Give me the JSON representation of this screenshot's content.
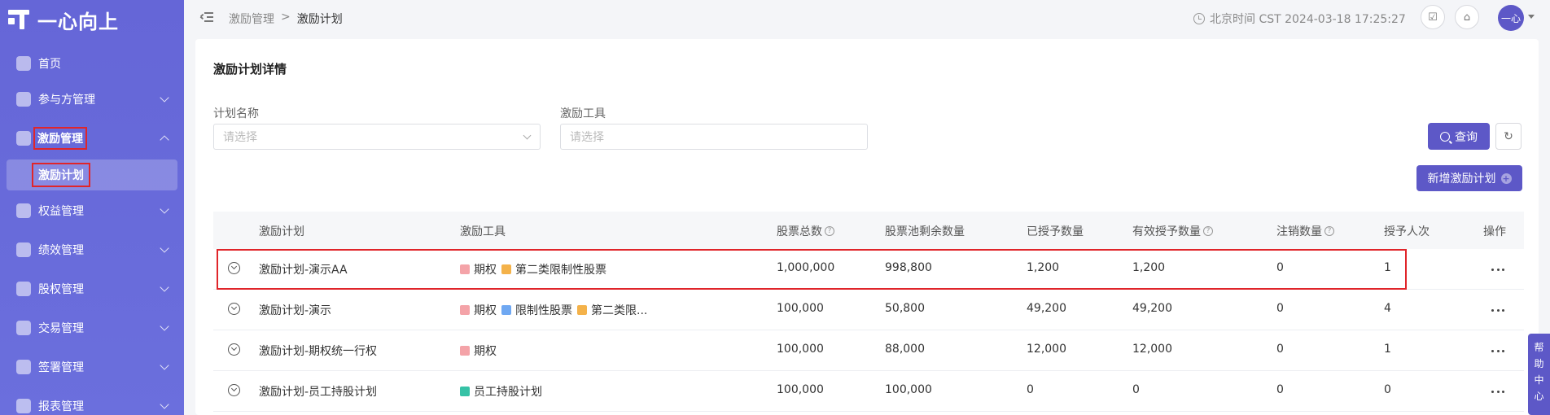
{
  "app": {
    "logo_text": "一心向上"
  },
  "sidebar": {
    "items": [
      {
        "label": "首页",
        "icon": "home-icon"
      },
      {
        "label": "参与方管理",
        "icon": "participant-icon"
      },
      {
        "label": "激励管理",
        "icon": "incentive-icon"
      },
      {
        "label": "权益管理",
        "icon": "rights-icon"
      },
      {
        "label": "绩效管理",
        "icon": "performance-icon"
      },
      {
        "label": "股权管理",
        "icon": "equity-icon"
      },
      {
        "label": "交易管理",
        "icon": "trade-icon"
      },
      {
        "label": "签署管理",
        "icon": "sign-icon"
      },
      {
        "label": "报表管理",
        "icon": "report-icon"
      }
    ],
    "submenu": {
      "label": "激励计划"
    }
  },
  "header": {
    "breadcrumb": [
      "激励管理",
      ">",
      "激励计划"
    ],
    "time_text": "北京时间 CST 2024-03-18 17:25:27",
    "avatar_text": "一心"
  },
  "card": {
    "title": "激励计划详情",
    "filters": {
      "plan_name_label": "计划名称",
      "plan_name_placeholder": "请选择",
      "tool_label": "激励工具",
      "tool_placeholder": "请选择"
    },
    "query_button": "查询",
    "add_button": "新增激励计划"
  },
  "table": {
    "columns": [
      "激励计划",
      "激励工具",
      "股票总数",
      "股票池剩余数量",
      "已授予数量",
      "有效授予数量",
      "注销数量",
      "授予人次",
      "操作"
    ],
    "rows": [
      {
        "plan": "激励计划-演示AA",
        "tools": [
          "期权",
          "第二类限制性股票"
        ],
        "total": "1,000,000",
        "remaining": "998,800",
        "granted": "1,200",
        "valid_granted": "1,200",
        "cancelled": "0",
        "grantees": "1"
      },
      {
        "plan": "激励计划-演示",
        "tools": [
          "期权",
          "限制性股票",
          "第二类限..."
        ],
        "total": "100,000",
        "remaining": "50,800",
        "granted": "49,200",
        "valid_granted": "49,200",
        "cancelled": "0",
        "grantees": "4"
      },
      {
        "plan": "激励计划-期权统一行权",
        "tools": [
          "期权"
        ],
        "total": "100,000",
        "remaining": "88,000",
        "granted": "12,000",
        "valid_granted": "12,000",
        "cancelled": "0",
        "grantees": "1"
      },
      {
        "plan": "激励计划-员工持股计划",
        "tools": [
          "员工持股计划"
        ],
        "total": "100,000",
        "remaining": "100,000",
        "granted": "0",
        "valid_granted": "0",
        "cancelled": "0",
        "grantees": "0"
      }
    ]
  },
  "help_tab": [
    "帮",
    "助",
    "中",
    "心"
  ],
  "colors": {
    "sidebar": "#6566d7",
    "primary": "#5d58c7",
    "highlight": "#e0252a"
  }
}
